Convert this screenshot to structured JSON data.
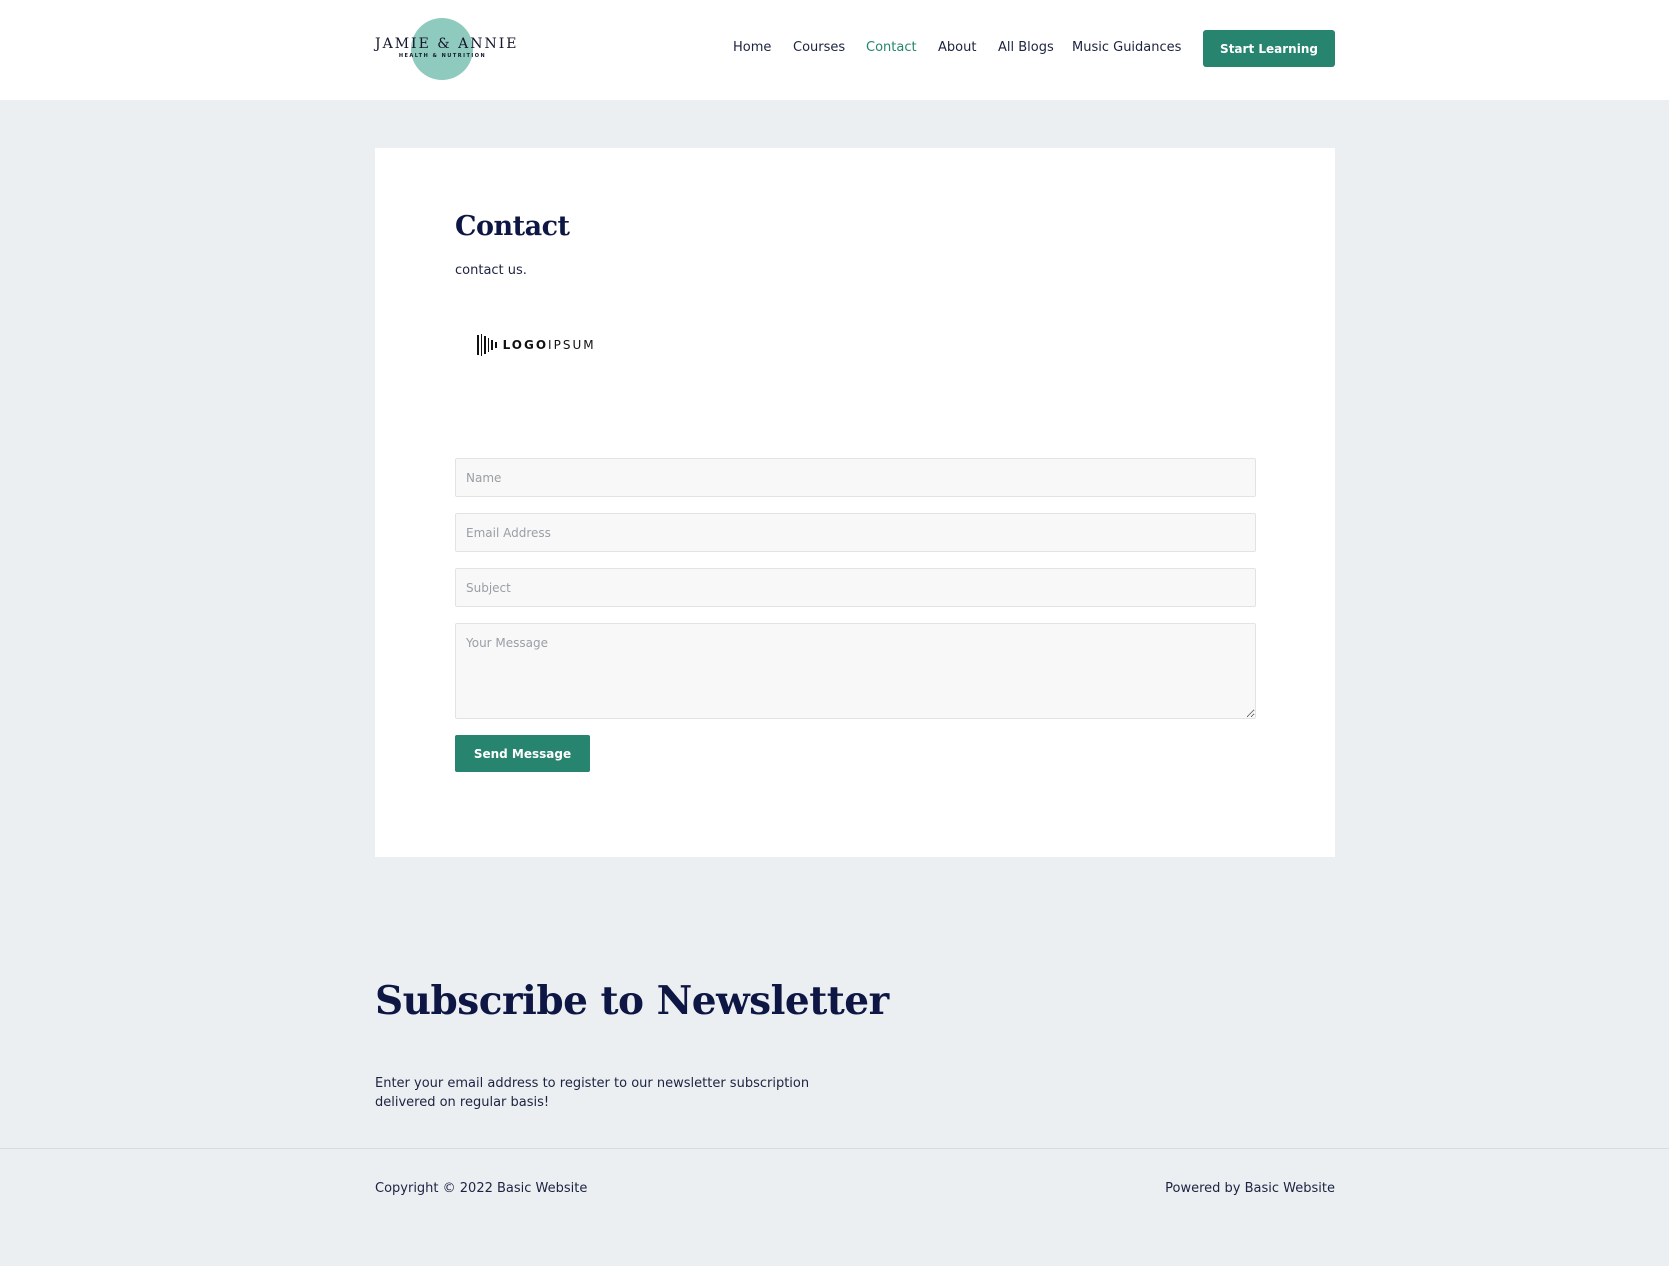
{
  "header": {
    "logo": {
      "title": "JAMIE & ANNIE",
      "subtitle": "HEALTH & NUTRITION"
    },
    "nav": [
      {
        "label": "Home",
        "active": false
      },
      {
        "label": "Courses",
        "active": false
      },
      {
        "label": "Contact",
        "active": true
      },
      {
        "label": "About",
        "active": false
      },
      {
        "label": "All Blogs",
        "active": false
      },
      {
        "label": "Music Guidances",
        "active": false
      }
    ],
    "cta_label": "Start Learning"
  },
  "contact": {
    "title": "Contact",
    "subtitle": "contact us.",
    "brand_logo": {
      "bold": "LOGO",
      "light": "IPSUM"
    },
    "form": {
      "name_placeholder": "Name",
      "email_placeholder": "Email Address",
      "subject_placeholder": "Subject",
      "message_placeholder": "Your Message",
      "submit_label": "Send Message"
    }
  },
  "newsletter": {
    "title": "Subscribe to Newsletter",
    "text": "Enter your email address to register to our newsletter subscription delivered on regular basis!"
  },
  "footer": {
    "copyright": "Copyright © 2022 Basic Website",
    "powered": "Powered by Basic Website"
  },
  "colors": {
    "accent": "#27846f",
    "heading": "#0e1744",
    "page_background": "#eceff2",
    "logo_circle": "#8fcabf"
  }
}
